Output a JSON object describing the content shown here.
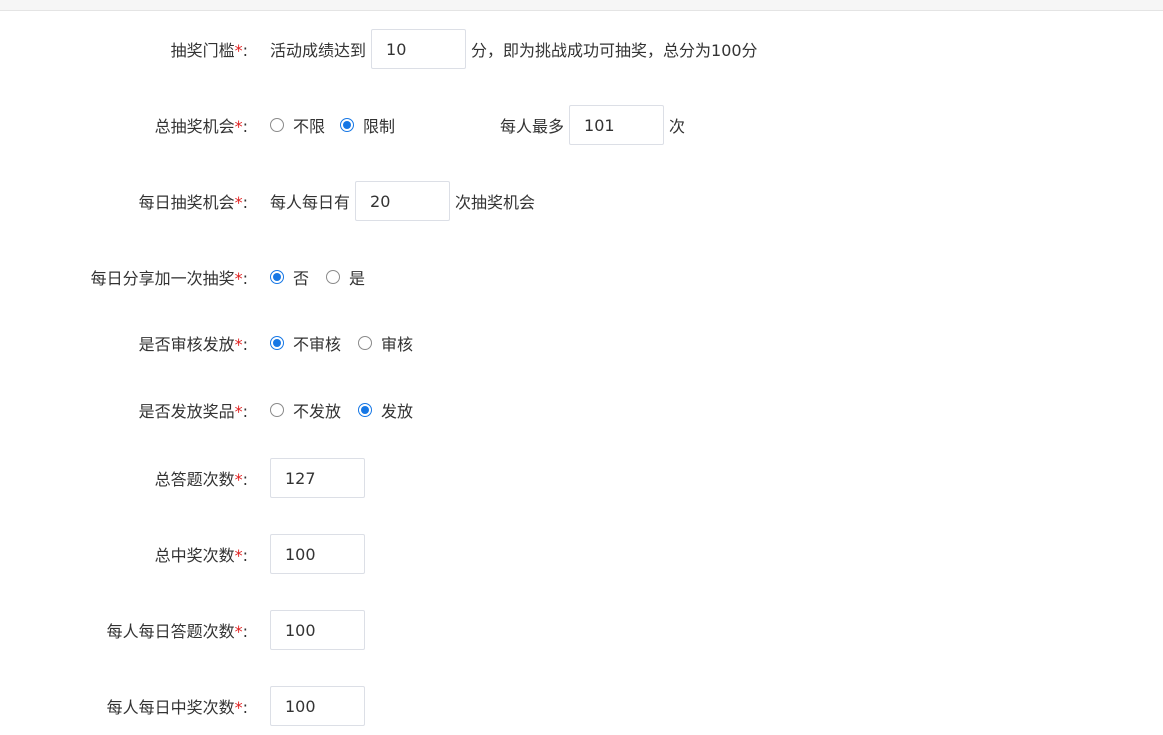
{
  "form": {
    "threshold": {
      "label": "抽奖门槛",
      "required_mark": "*",
      "colon": ":",
      "prefix": "活动成绩达到",
      "value": "10",
      "suffix": "分，即为挑战成功可抽奖，总分为100分"
    },
    "total_chances": {
      "label": "总抽奖机会",
      "required_mark": "*",
      "colon": ":",
      "options": [
        {
          "label": "不限",
          "checked": false
        },
        {
          "label": "限制",
          "checked": true
        }
      ],
      "limit_prefix": "每人最多",
      "limit_value": "101",
      "limit_suffix": "次"
    },
    "daily_chances": {
      "label": "每日抽奖机会",
      "required_mark": "*",
      "colon": ":",
      "prefix": "每人每日有",
      "value": "20",
      "suffix": "次抽奖机会"
    },
    "daily_share": {
      "label": "每日分享加一次抽奖",
      "required_mark": "*",
      "colon": ":",
      "options": [
        {
          "label": "否",
          "checked": true
        },
        {
          "label": "是",
          "checked": false
        }
      ]
    },
    "review": {
      "label": "是否审核发放",
      "required_mark": "*",
      "colon": ":",
      "options": [
        {
          "label": "不审核",
          "checked": true
        },
        {
          "label": "审核",
          "checked": false
        }
      ]
    },
    "prize_issue": {
      "label": "是否发放奖品",
      "required_mark": "*",
      "colon": ":",
      "options": [
        {
          "label": "不发放",
          "checked": false
        },
        {
          "label": "发放",
          "checked": true
        }
      ]
    },
    "total_answers": {
      "label": "总答题次数",
      "required_mark": "*",
      "colon": ":",
      "value": "127"
    },
    "total_wins": {
      "label": "总中奖次数",
      "required_mark": "*",
      "colon": ":",
      "value": "100"
    },
    "daily_answers": {
      "label": "每人每日答题次数",
      "required_mark": "*",
      "colon": ":",
      "value": "100"
    },
    "daily_wins": {
      "label": "每人每日中奖次数",
      "required_mark": "*",
      "colon": ":",
      "value": "100"
    }
  },
  "colors": {
    "accent": "#1677e5",
    "required": "#e02020",
    "text": "#333333",
    "border": "#dcdfe6"
  }
}
